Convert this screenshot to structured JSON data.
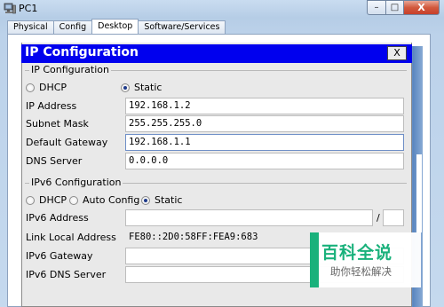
{
  "window": {
    "title": "PC1",
    "minimize": "–",
    "maximize": "□",
    "close": "X"
  },
  "tabs": [
    {
      "label": "Physical",
      "active": false
    },
    {
      "label": "Config",
      "active": false
    },
    {
      "label": "Desktop",
      "active": true
    },
    {
      "label": "Software/Services",
      "active": false
    }
  ],
  "dialog": {
    "title": "IP Configuration",
    "close_label": "X",
    "ipv4": {
      "group_label": "IP Configuration",
      "modes": [
        {
          "label": "DHCP",
          "selected": false
        },
        {
          "label": "Static",
          "selected": true
        }
      ],
      "fields": [
        {
          "label": "IP Address",
          "value": "192.168.1.2"
        },
        {
          "label": "Subnet Mask",
          "value": "255.255.255.0"
        },
        {
          "label": "Default Gateway",
          "value": "192.168.1.1"
        },
        {
          "label": "DNS Server",
          "value": "0.0.0.0"
        }
      ]
    },
    "ipv6": {
      "group_label": "IPv6 Configuration",
      "modes": [
        {
          "label": "DHCP",
          "selected": false
        },
        {
          "label": "Auto Config",
          "selected": false
        },
        {
          "label": "Static",
          "selected": true
        }
      ],
      "address_label": "IPv6 Address",
      "address_value": "",
      "prefix_separator": "/",
      "prefix_value": "",
      "link_local_label": "Link Local Address",
      "link_local_value": "FE80::2D0:58FF:FEA9:683",
      "gateway_label": "IPv6 Gateway",
      "gateway_value": "",
      "dns_label": "IPv6 DNS Server",
      "dns_value": ""
    }
  },
  "watermark": {
    "main": "百科全说",
    "sub": "助你轻松解决"
  },
  "colors": {
    "dialog_title_bg": "#0000ee",
    "watermark_green": "#19b17b",
    "selected_radio": "#1e3a8a"
  }
}
